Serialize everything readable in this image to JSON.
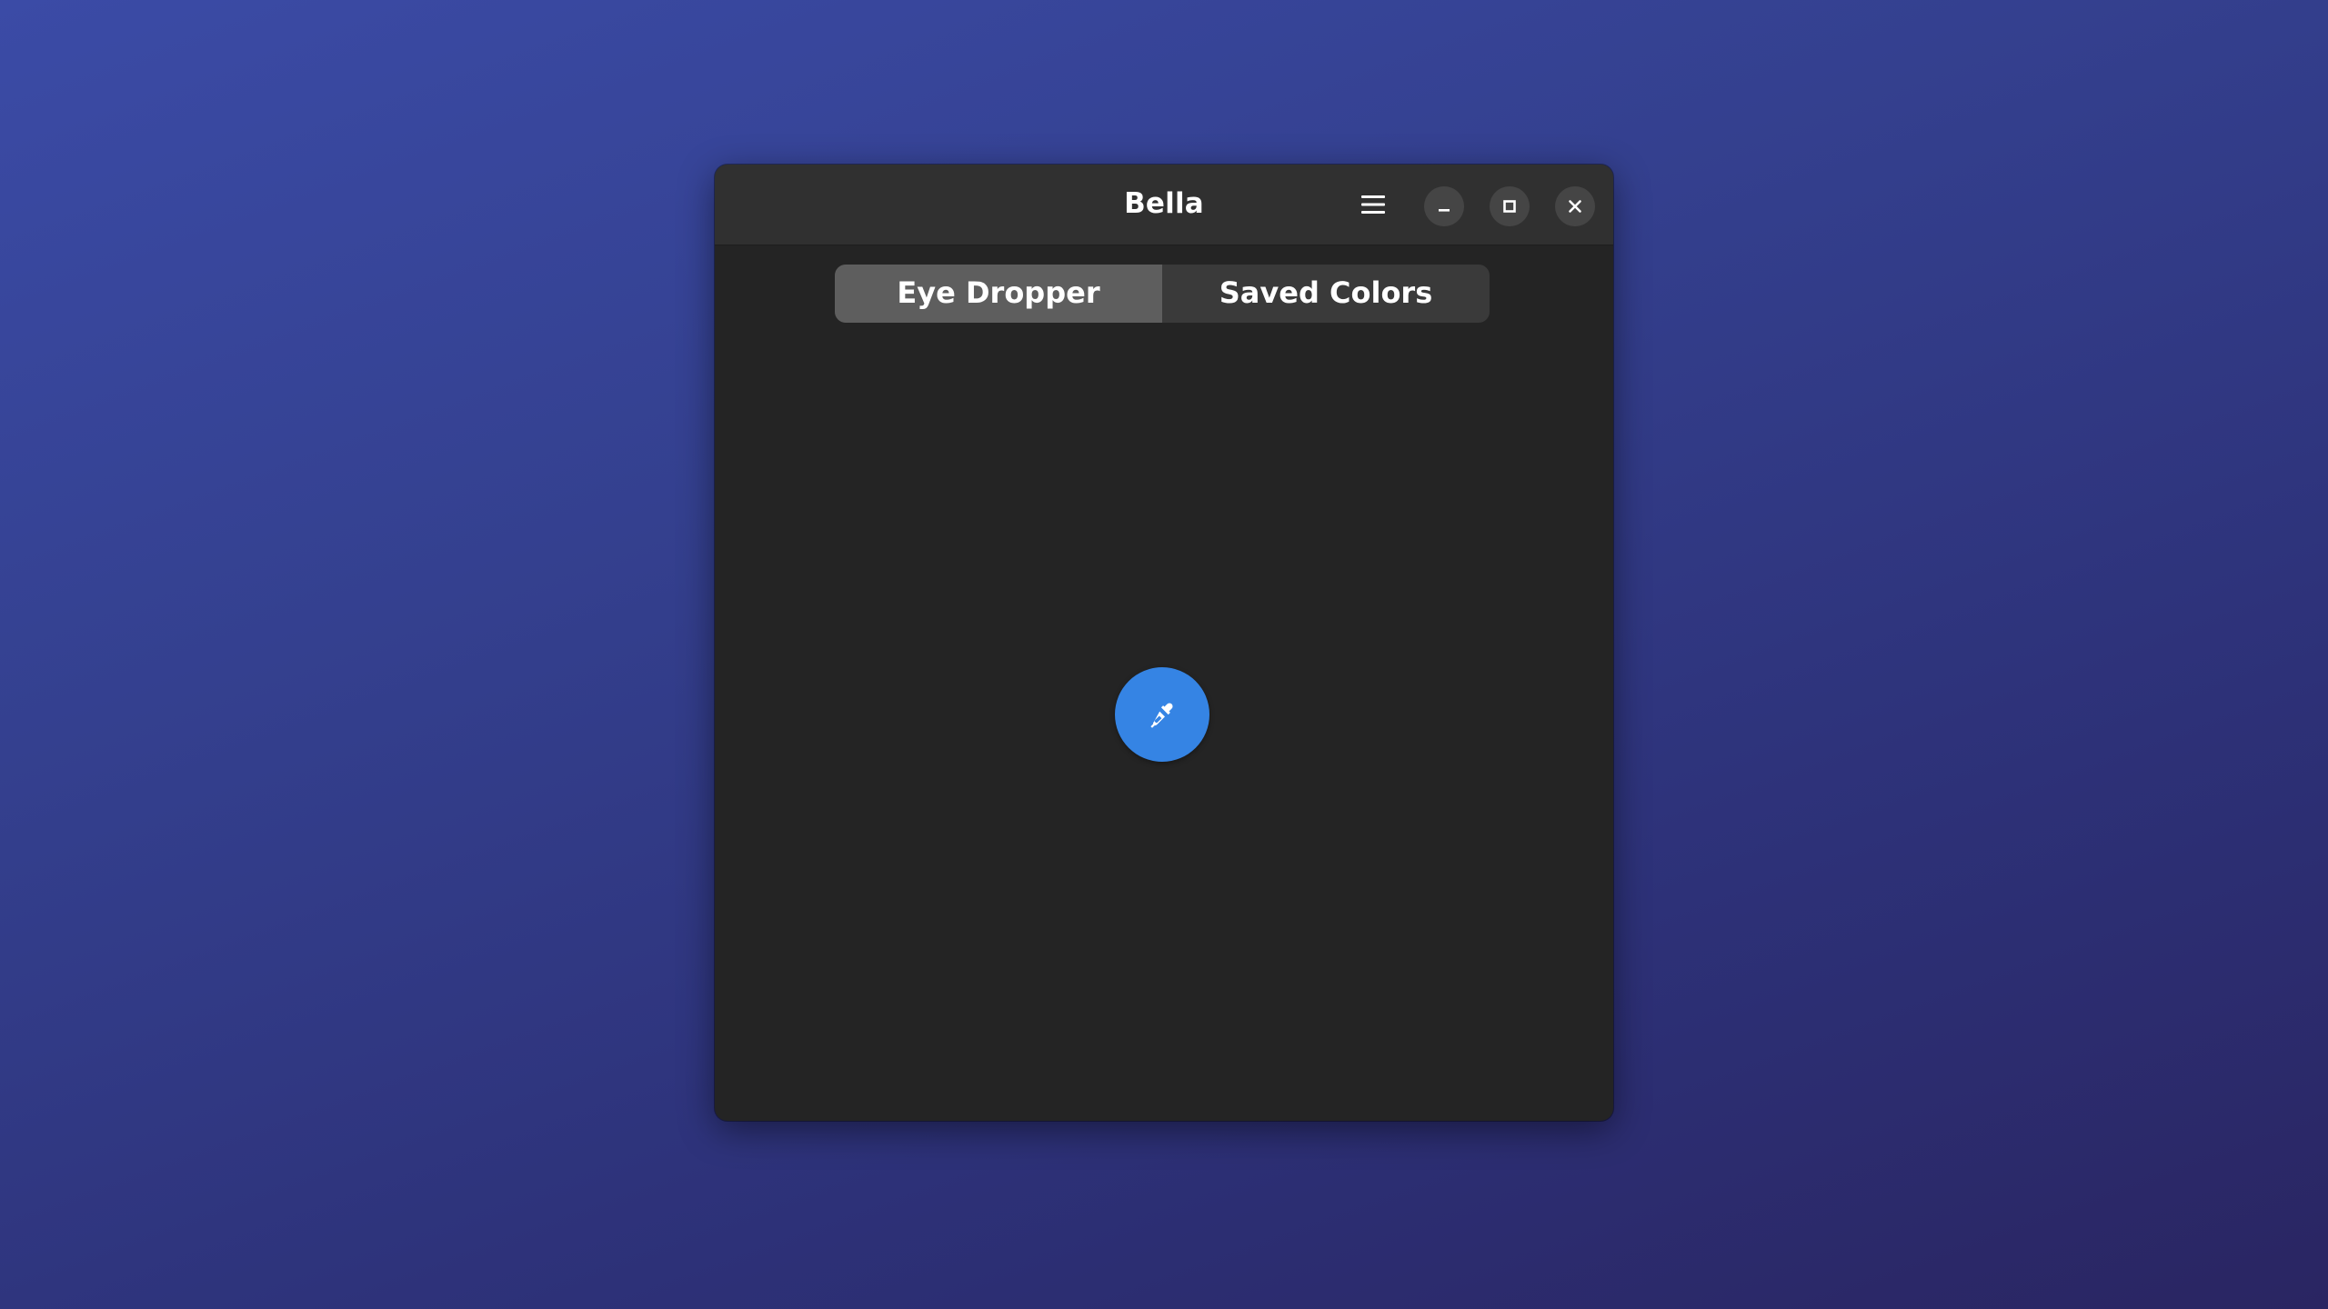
{
  "window": {
    "title": "Bella"
  },
  "headerbar": {
    "menu_icon": "hamburger-menu-icon",
    "minimize_icon": "minimize-icon",
    "maximize_icon": "maximize-icon",
    "close_icon": "close-icon"
  },
  "view_switcher": {
    "tabs": [
      {
        "label": "Eye Dropper",
        "active": true
      },
      {
        "label": "Saved Colors",
        "active": false
      }
    ]
  },
  "main": {
    "pick_button_icon": "eyedropper-icon"
  },
  "colors": {
    "desktop_top": "#3b4ba6",
    "desktop_bottom": "#2a2562",
    "window_bg": "#242424",
    "headerbar_bg": "#303030",
    "accent": "#3584e4",
    "tab_active_bg": "#5e5e5e",
    "tab_inactive_bg": "#3a3a3a"
  }
}
